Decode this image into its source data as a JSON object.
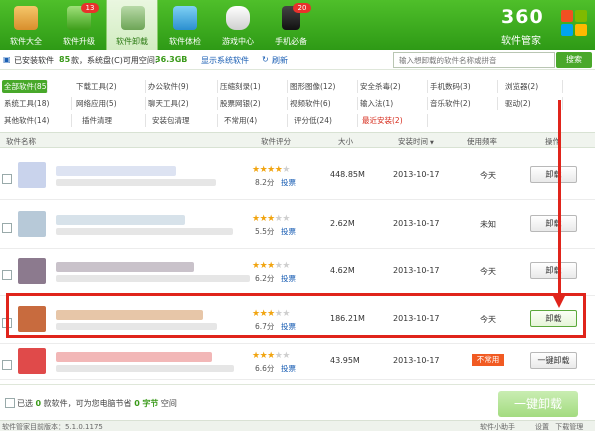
{
  "nav": {
    "tabs": [
      {
        "label": "软件大全",
        "icon": "software-box-icon",
        "badge": ""
      },
      {
        "label": "软件升级",
        "icon": "upgrade-arrow-icon",
        "badge": "13"
      },
      {
        "label": "软件卸载",
        "icon": "trash-can-icon",
        "badge": ""
      },
      {
        "label": "软件体检",
        "icon": "monitor-check-icon",
        "badge": ""
      },
      {
        "label": "游戏中心",
        "icon": "gamepad-icon",
        "badge": ""
      },
      {
        "label": "手机必备",
        "icon": "mobile-phone-icon",
        "badge": "20"
      }
    ],
    "active_index": 2
  },
  "brand": {
    "number": "360",
    "name": "软件管家"
  },
  "info": {
    "installed_label": "已安装软件",
    "installed_count": "85",
    "installed_unit": "款，系统盘(C)可用空间:",
    "free_space": "36.3GB",
    "show_system": "显示系统软件",
    "refresh": "刷新",
    "search_placeholder": "输入想卸载的软件名称或拼音",
    "search_button": "搜索"
  },
  "categories": [
    [
      "全部软件(85)",
      "下载工具(2)",
      "办公软件(9)",
      "压缩刻录(1)",
      "图形图像(12)",
      "安全杀毒(2)",
      "手机数码(3)",
      "浏览器(2)"
    ],
    [
      "系统工具(18)",
      "网络应用(5)",
      "聊天工具(2)",
      "股票网银(2)",
      "视频软件(6)",
      "输入法(1)",
      "音乐软件(2)",
      "驱动(2)"
    ],
    [
      "其他软件(14)",
      "插件清理",
      "安装包清理",
      "不常用(4)",
      "评分低(24)",
      "最近安装(2)"
    ]
  ],
  "table": {
    "headers": {
      "name": "软件名称",
      "rating": "软件评分",
      "size": "大小",
      "date": "安装时间",
      "freq": "使用频率",
      "action": "操作"
    },
    "vote_label": "投票",
    "uninstall_label": "卸载",
    "rows": [
      {
        "stars": 4.5,
        "score": "8.2分",
        "size": "448.85M",
        "date": "2013-10-17",
        "freq": "今天",
        "action": "卸载"
      },
      {
        "stars": 3,
        "score": "5.5分",
        "size": "2.62M",
        "date": "2013-10-17",
        "freq": "未知",
        "action": "卸载"
      },
      {
        "stars": 3,
        "score": "6.2分",
        "size": "4.62M",
        "date": "2013-10-17",
        "freq": "今天",
        "action": "卸载"
      },
      {
        "stars": 3.5,
        "score": "6.7分",
        "size": "186.21M",
        "date": "2013-10-17",
        "freq": "今天",
        "action": "卸载"
      },
      {
        "stars": 3,
        "score": "6.6分",
        "size": "43.95M",
        "date": "2013-10-17",
        "freq": "不常用",
        "action": "一键卸载"
      }
    ]
  },
  "bottom": {
    "selected_prefix": "已选",
    "selected_count": "0",
    "selected_mid": "款软件，可为您电脑节省",
    "saved_value": "0",
    "saved_unit": "字节",
    "saved_suffix": "空间",
    "one_click_button": "一键卸载"
  },
  "status": {
    "version": "软件管家目前版本：5.1.0.1175",
    "helper": "软件小助手",
    "settings": "设置",
    "download_manager": "下载管理"
  },
  "colors": {
    "brand_green": "#3aa81c",
    "highlight_red": "#e0241b",
    "link_blue": "#1b5fb4"
  }
}
